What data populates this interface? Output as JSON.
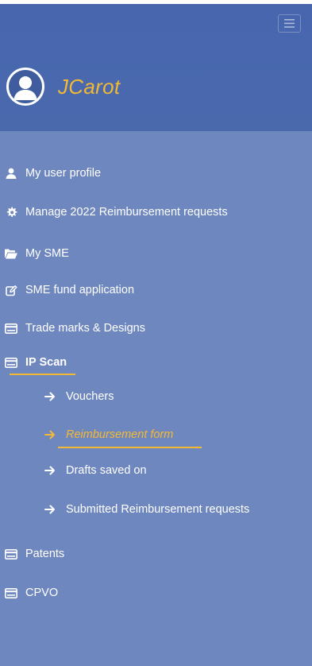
{
  "header": {
    "username": "JCarot",
    "menu_toggle_icon": "hamburger-icon",
    "avatar_icon": "user-avatar-icon"
  },
  "colors": {
    "header_bg": "#4a69ad",
    "sidebar_bg": "#6f87bf",
    "accent": "#f2b935",
    "text": "#ffffff"
  },
  "sidebar": {
    "items": [
      {
        "label": "My user profile",
        "icon": "user-icon"
      },
      {
        "label": "Manage 2022 Reimbursement requests",
        "icon": "gear-icon"
      },
      {
        "label": "My SME",
        "icon": "folder-open-icon"
      },
      {
        "label": "SME fund application",
        "icon": "edit-icon"
      },
      {
        "label": "Trade marks & Designs",
        "icon": "card-icon"
      },
      {
        "label": "IP Scan",
        "icon": "card-icon",
        "active": true
      },
      {
        "label": "Patents",
        "icon": "card-icon"
      },
      {
        "label": "CPVO",
        "icon": "card-icon"
      }
    ],
    "ip_scan_sub": [
      {
        "label": "Vouchers",
        "icon": "arrow-right-icon"
      },
      {
        "label": "Reimbursement form",
        "icon": "arrow-right-icon",
        "current": true
      },
      {
        "label": "Drafts saved on",
        "icon": "arrow-right-icon"
      },
      {
        "label": "Submitted Reimbursement requests",
        "icon": "arrow-right-icon"
      }
    ]
  }
}
